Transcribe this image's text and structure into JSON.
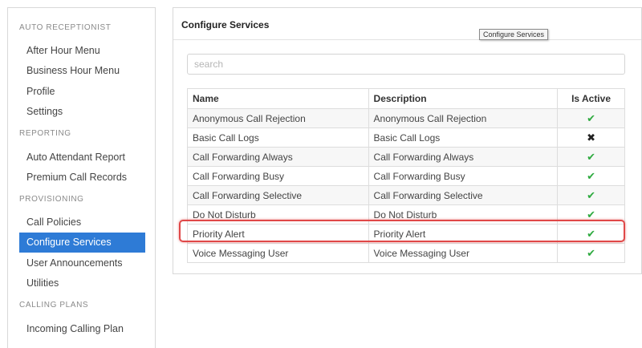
{
  "sidebar": {
    "sections": {
      "auto_receptionist": "AUTO RECEPTIONIST",
      "reporting": "REPORTING",
      "provisioning": "PROVISIONING",
      "calling_plans": "CALLING PLANS"
    },
    "items": {
      "after_hour_menu": "After Hour Menu",
      "business_hour_menu": "Business Hour Menu",
      "profile": "Profile",
      "settings": "Settings",
      "auto_attendant_report": "Auto Attendant Report",
      "premium_call_records": "Premium Call Records",
      "call_policies": "Call Policies",
      "configure_services": "Configure Services",
      "user_announcements": "User Announcements",
      "utilities": "Utilities",
      "incoming_calling_plan": "Incoming Calling Plan"
    },
    "active_item": "Configure Services"
  },
  "panel": {
    "title": "Configure Services",
    "tooltip": "Configure Services",
    "search_placeholder": "search"
  },
  "table": {
    "headers": {
      "name": "Name",
      "description": "Description",
      "is_active": "Is Active"
    },
    "rows": [
      {
        "name": "Anonymous Call Rejection",
        "description": "Anonymous Call Rejection",
        "active": "✔"
      },
      {
        "name": "Basic Call Logs",
        "description": "Basic Call Logs",
        "active": "✖"
      },
      {
        "name": "Call Forwarding Always",
        "description": "Call Forwarding Always",
        "active": "✔"
      },
      {
        "name": "Call Forwarding Busy",
        "description": "Call Forwarding Busy",
        "active": "✔"
      },
      {
        "name": "Call Forwarding Selective",
        "description": "Call Forwarding Selective",
        "active": "✔"
      },
      {
        "name": "Do Not Disturb",
        "description": "Do Not Disturb",
        "active": "✔"
      },
      {
        "name": "Priority Alert",
        "description": "Priority Alert",
        "active": "✔"
      },
      {
        "name": "Voice Messaging User",
        "description": "Voice Messaging User",
        "active": "✔"
      }
    ],
    "highlighted_row": "Priority Alert"
  },
  "colors": {
    "active_item_bg": "#2e7bd6",
    "check": "#2eaa3f",
    "highlight_border": "#e04848"
  },
  "icons": {
    "active": "check-icon",
    "inactive": "cross-icon"
  }
}
